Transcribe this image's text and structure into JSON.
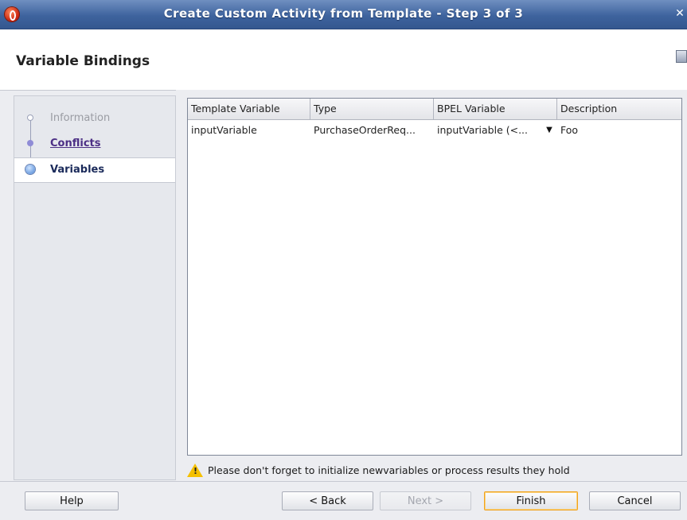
{
  "window": {
    "title": "Create Custom Activity from Template - Step 3 of 3",
    "close_glyph": "✕"
  },
  "header": {
    "title": "Variable Bindings"
  },
  "nav": {
    "steps": [
      {
        "label": "Information",
        "state": "completed"
      },
      {
        "label": "Conflicts",
        "state": "link"
      },
      {
        "label": "Variables",
        "state": "current"
      }
    ]
  },
  "table": {
    "columns": [
      "Template Variable",
      "Type",
      "BPEL Variable",
      "Description"
    ],
    "rows": [
      {
        "template_variable": "inputVariable",
        "type": "PurchaseOrderReq...",
        "bpel_variable": "inputVariable (<...",
        "description": "Foo"
      }
    ]
  },
  "warning": {
    "icon": "warning-triangle-icon",
    "text": "Please don't forget to initialize newvariables or process results they hold"
  },
  "buttons": {
    "help": "Help",
    "back": "< Back",
    "next": "Next >",
    "finish": "Finish",
    "cancel": "Cancel"
  },
  "colors": {
    "titlebar": "#3e639e",
    "default_button_border": "#f0a21c",
    "warning": "#f5c000"
  }
}
